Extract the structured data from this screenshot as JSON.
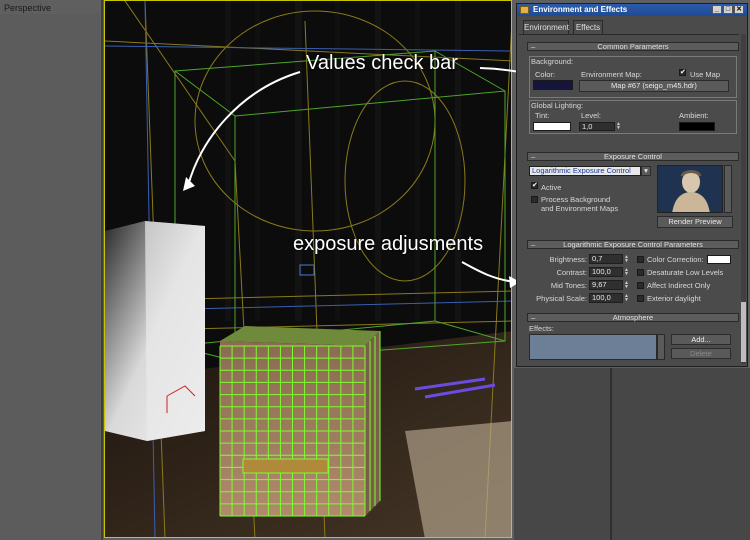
{
  "viewport": {
    "label": "Perspective"
  },
  "annotations": {
    "values_check_bar": "Values check bar",
    "exposure_adjustments": "exposure adjusments"
  },
  "dialog": {
    "title": "Environment and Effects",
    "tabs": [
      "Environment",
      "Effects"
    ],
    "common": {
      "header": "Common Parameters",
      "background_label": "Background:",
      "color_label": "Color:",
      "env_map_label": "Environment Map:",
      "use_map_label": "Use Map",
      "use_map_checked": true,
      "map_button": "Map #67 (seigo_m45.hdr)",
      "global_lighting_label": "Global Lighting:",
      "tint_label": "Tint:",
      "level_label": "Level:",
      "level_value": "1,0",
      "ambient_label": "Ambient:",
      "background_color": "#14143c",
      "tint_color": "#ffffff",
      "ambient_color": "#000000"
    },
    "exposure": {
      "header": "Exposure Control",
      "dropdown_value": "Logarithmic Exposure Control",
      "active_label": "Active",
      "active_checked": true,
      "process_bg_label": "Process Background and Environment Maps",
      "render_preview_button": "Render Preview"
    },
    "log_params": {
      "header": "Logarithmic Exposure Control Parameters",
      "brightness_label": "Brightness:",
      "brightness_value": "0,7",
      "contrast_label": "Contrast:",
      "contrast_value": "100,0",
      "midtones_label": "Mid Tones:",
      "midtones_value": "9,67",
      "physical_scale_label": "Physical Scale:",
      "physical_scale_value": "100,0",
      "color_correction_label": "Color Correction:",
      "color_correction_color": "#ffffff",
      "desaturate_label": "Desaturate Low Levels",
      "affect_indirect_label": "Affect Indirect Only",
      "exterior_daylight_label": "Exterior daylight"
    },
    "atmosphere": {
      "header": "Atmosphere",
      "effects_label": "Effects:",
      "add_button": "Add...",
      "delete_button": "Delete"
    }
  },
  "colors": {
    "viewport_frame": "#c9c400",
    "box_wire": "#7cff2e",
    "grid_blue": "#3a5fb0",
    "grid_yellow": "#8a7a1a"
  }
}
